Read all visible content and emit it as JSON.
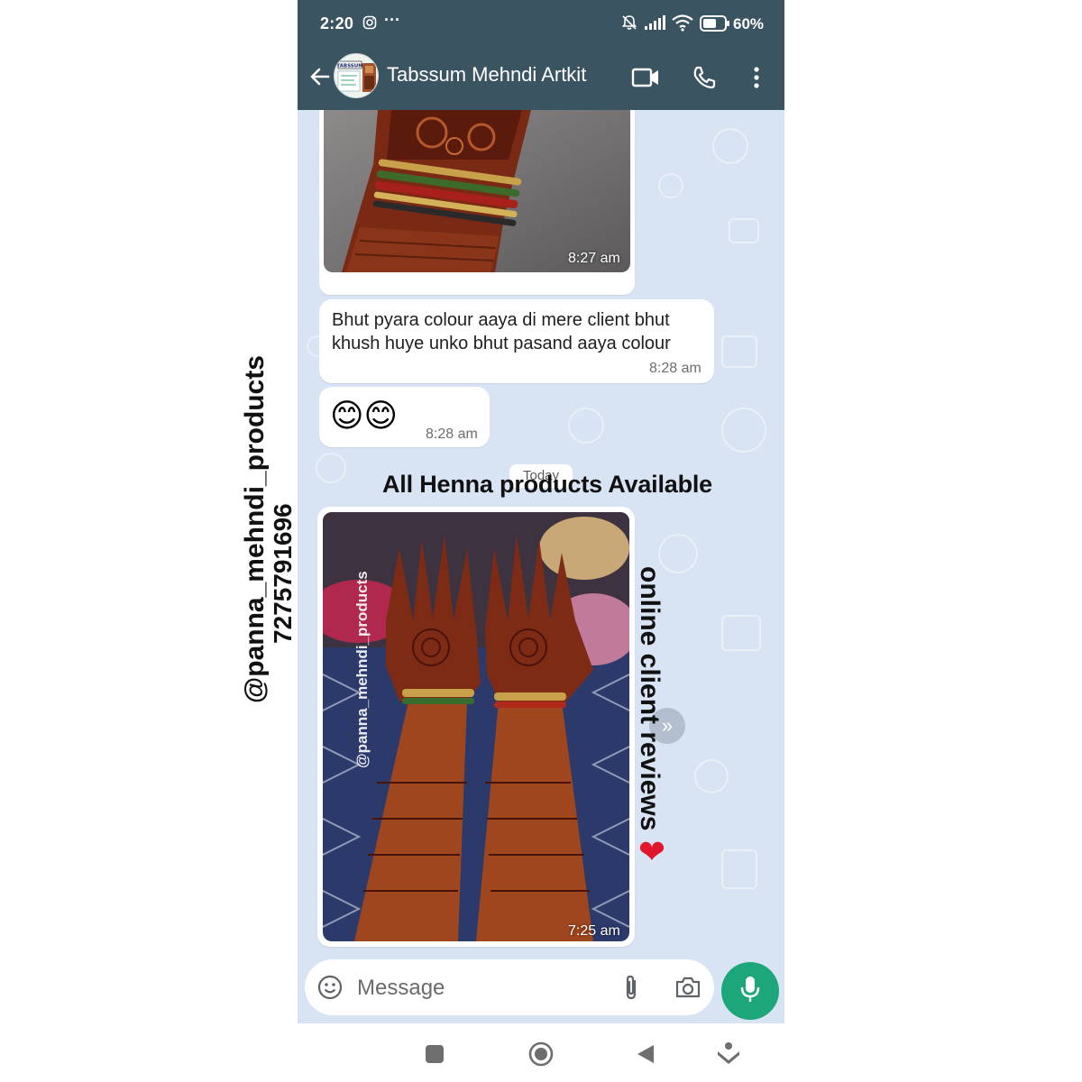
{
  "status_bar": {
    "time": "2:20",
    "dots": "···",
    "battery_percent": "60%",
    "icons": [
      "instagram-icon",
      "muted-bell-icon",
      "signal-icon",
      "wifi-icon",
      "battery-icon"
    ]
  },
  "app_bar": {
    "title": "Tabssum Mehndi Artkit",
    "avatar_text": "TABSSUM",
    "icons": [
      "back-arrow-icon",
      "video-call-icon",
      "phone-call-icon",
      "more-vert-icon"
    ]
  },
  "messages": [
    {
      "type": "image",
      "time": "8:27 am"
    },
    {
      "type": "text",
      "text": "Bhut pyara colour aaya di mere client bhut khush huye unko bhut pasand aaya colour",
      "time": "8:28 am"
    },
    {
      "type": "emoji",
      "text": "😊😊",
      "time": "8:28 am"
    },
    {
      "type": "date-chip",
      "text": "Today"
    },
    {
      "type": "image",
      "time": "7:25 am",
      "watermark": "@panna_mehndi_products"
    }
  ],
  "forward_icon": "»",
  "input": {
    "placeholder": "Message",
    "icons": [
      "emoji-icon",
      "attach-icon",
      "camera-icon",
      "mic-icon"
    ]
  },
  "nav_bar": {
    "icons": [
      "recents-icon",
      "home-icon",
      "back-icon",
      "assistant-icon"
    ]
  },
  "overlay": {
    "title": "All Henna products Available",
    "left_handle": "@panna_mehndi_products",
    "left_phone": "7275791696",
    "right_caption": "online client reviews",
    "right_heart": "❤"
  },
  "colors": {
    "header": "#3b5462",
    "chat_background": "#d8e3f3",
    "bubble": "#ffffff",
    "mic_button": "#1da67a"
  }
}
